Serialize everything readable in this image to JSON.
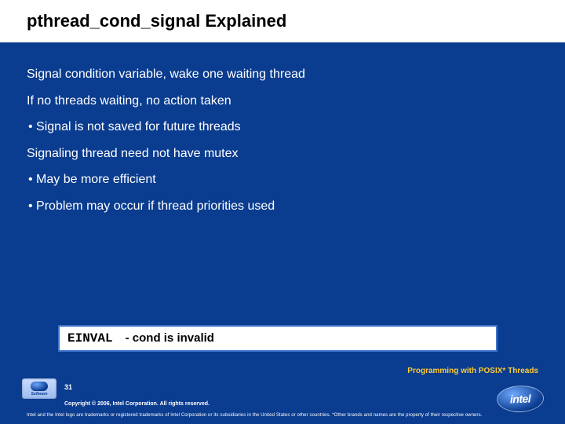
{
  "title": "pthread_cond_signal Explained",
  "body": {
    "p1": "Signal condition variable, wake one waiting thread",
    "p2": "If no threads waiting, no action taken",
    "b1": "Signal is not saved for future threads",
    "p3": "Signaling thread need not have mutex",
    "b2": "May be more efficient",
    "b3": "Problem may occur if thread priorities used"
  },
  "error": {
    "code": "EINVAL",
    "desc": "- cond is invalid"
  },
  "footer": {
    "course": "Programming with POSIX* Threads",
    "page": "31",
    "copyright": "Copyright © 2006, Intel Corporation. All rights reserved.",
    "trademark": "Intel and the Intel logo are trademarks or registered trademarks of Intel Corporation or its subsidiaries in the United States or other countries. *Other brands and names are the property of their respective owners."
  },
  "logos": {
    "software_label": "Software",
    "intel_label": "intel"
  }
}
